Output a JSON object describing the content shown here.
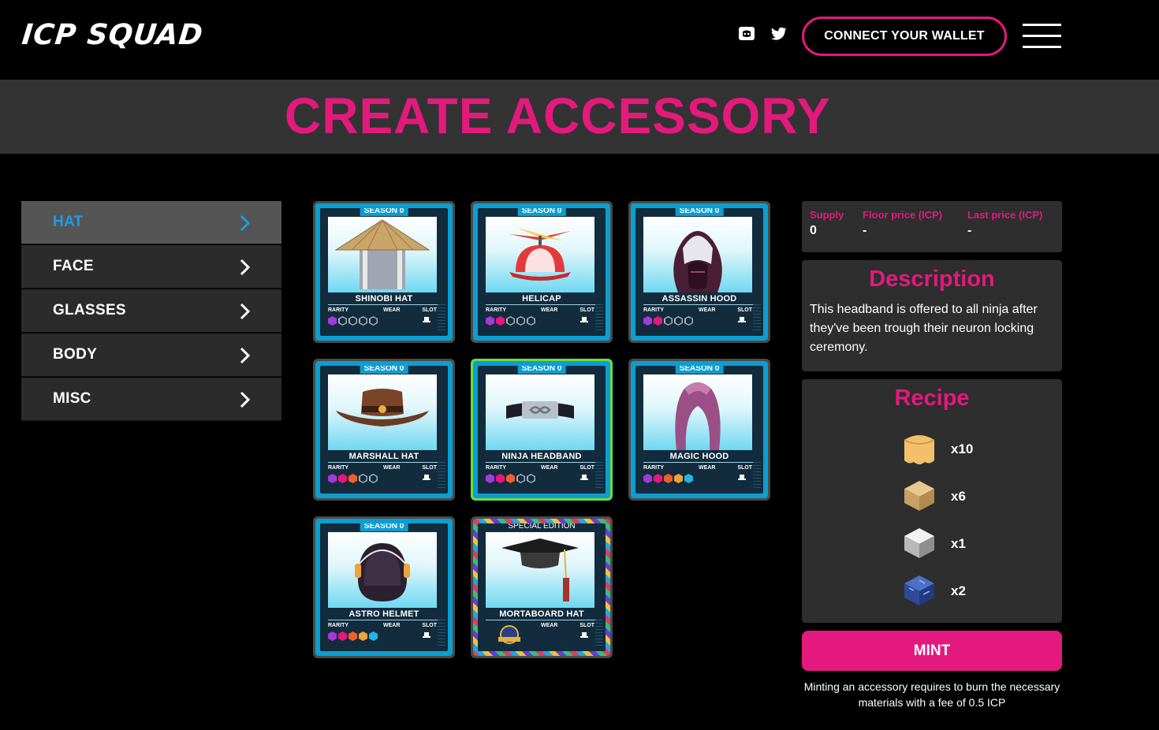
{
  "header": {
    "logo": "ICP SQUAD",
    "connect_wallet": "CONNECT YOUR WALLET",
    "social": [
      "discord-icon",
      "twitter-icon"
    ]
  },
  "page": {
    "title": "CREATE ACCESSORY"
  },
  "sidebar": {
    "items": [
      {
        "label": "HAT",
        "active": true
      },
      {
        "label": "FACE",
        "active": false
      },
      {
        "label": "GLASSES",
        "active": false
      },
      {
        "label": "BODY",
        "active": false
      },
      {
        "label": "MISC",
        "active": false
      }
    ]
  },
  "card_labels": {
    "rarity": "RARITY",
    "wear": "WEAR",
    "slot": "SLOT"
  },
  "cards": [
    {
      "season": "SEASON 0",
      "name": "SHINOBI HAT",
      "rarity": 1
    },
    {
      "season": "SEASON 0",
      "name": "HELICAP",
      "rarity": 2
    },
    {
      "season": "SEASON 0",
      "name": "ASSASSIN HOOD",
      "rarity": 2
    },
    {
      "season": "SEASON 0",
      "name": "MARSHALL HAT",
      "rarity": 3
    },
    {
      "season": "SEASON 0",
      "name": "NINJA HEADBAND",
      "rarity": 3,
      "selected": true
    },
    {
      "season": "SEASON 0",
      "name": "MAGIC HOOD",
      "rarity": 5
    },
    {
      "season": "SEASON 0",
      "name": "ASTRO HELMET",
      "rarity": 5
    },
    {
      "season": "SPECIAL EDITION",
      "name": "MORTABOARD HAT",
      "rarity": 0,
      "special": true
    }
  ],
  "rarity_colors": [
    "#a43ad9",
    "#e3197d",
    "#f0602a",
    "#f2a23a",
    "#23b5e6"
  ],
  "stats": {
    "supply_label": "Supply",
    "supply": "0",
    "floor_label": "Floor price (ICP)",
    "floor": "-",
    "last_label": "Last price (ICP)",
    "last": "-"
  },
  "description": {
    "title": "Description",
    "text": "This headband is offered to all ninja after they've been trough their neuron locking ceremony."
  },
  "recipe": {
    "title": "Recipe",
    "items": [
      {
        "icon": "cloth-icon",
        "qty": "x10"
      },
      {
        "icon": "wood-icon",
        "qty": "x6"
      },
      {
        "icon": "metal-icon",
        "qty": "x1"
      },
      {
        "icon": "circuit-icon",
        "qty": "x2"
      }
    ]
  },
  "mint": {
    "label": "MINT",
    "note": "Minting an accessory requires to burn the necessary materials with a fee of 0.5 ICP"
  }
}
